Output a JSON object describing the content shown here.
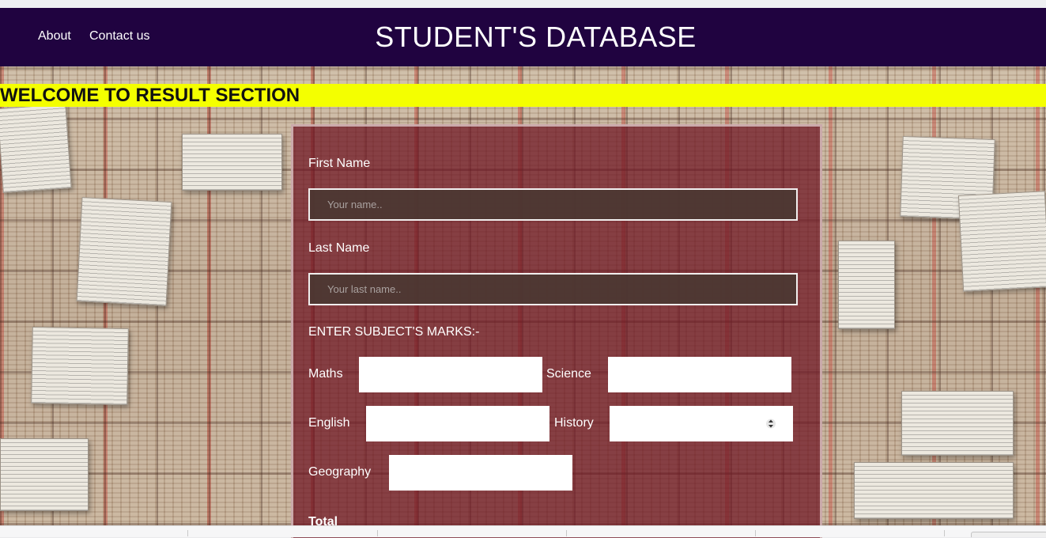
{
  "nav": {
    "about_label": "About",
    "contact_label": "Contact us",
    "title": "STUDENT'S DATABASE"
  },
  "banner": {
    "text": "WELCOME TO RESULT SECTION"
  },
  "form": {
    "first_name_label": "First Name",
    "first_name_placeholder": "Your name..",
    "first_name_value": "",
    "last_name_label": "Last Name",
    "last_name_placeholder": "Your last name..",
    "last_name_value": "",
    "marks_heading": "ENTER SUBJECT'S MARKS:-",
    "subjects": {
      "maths": "Maths",
      "science": "Science",
      "english": "English",
      "history": "History",
      "geography": "Geography"
    },
    "total_label": "Total"
  },
  "colors": {
    "navbar": "#200340",
    "banner": "#f4ff00",
    "panel": "#6e1623"
  },
  "icons": {
    "history_spinner": "spinner-arrows-icon"
  }
}
